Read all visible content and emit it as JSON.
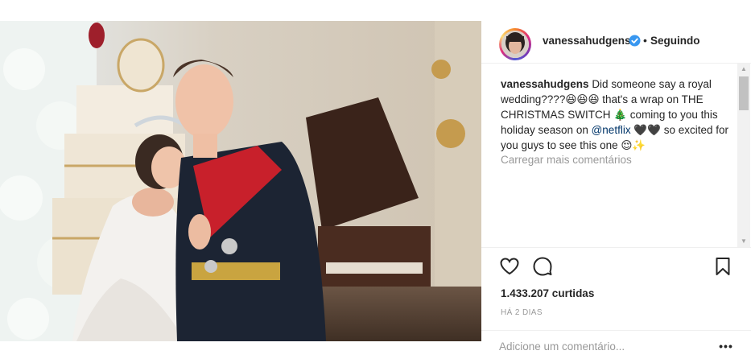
{
  "post": {
    "photo_alt": "",
    "header": {
      "username": "vanessahudgens",
      "verified": true,
      "separator": "•",
      "follow_status": "Seguindo"
    },
    "caption": {
      "username": "vanessahudgens",
      "text_part1": "Did someone say a royal wedding????😆😆😆 that's a wrap on THE CHRISTMAS SWITCH 🎄 coming to you this holiday season on ",
      "mention": "@netflix",
      "text_part2": " 🖤🖤 so excited for you guys to see this one 😌✨"
    },
    "load_more_comments": "Carregar mais comentários",
    "likes": "1.433.207 curtidas",
    "time_ago": "HÁ 2 DIAS",
    "comment_input": {
      "placeholder": "Adicione um comentário...",
      "value": ""
    },
    "more_options": "•••",
    "scroll_up": "▲",
    "scroll_down": "▼"
  },
  "colors": {
    "text": "#262626",
    "muted": "#999999",
    "mention": "#003569",
    "verified": "#3897f0",
    "border": "#efefef"
  },
  "icons": {
    "like": "heart-icon",
    "comment": "comment-bubble-icon",
    "save": "bookmark-icon",
    "verified": "verified-badge-icon"
  }
}
